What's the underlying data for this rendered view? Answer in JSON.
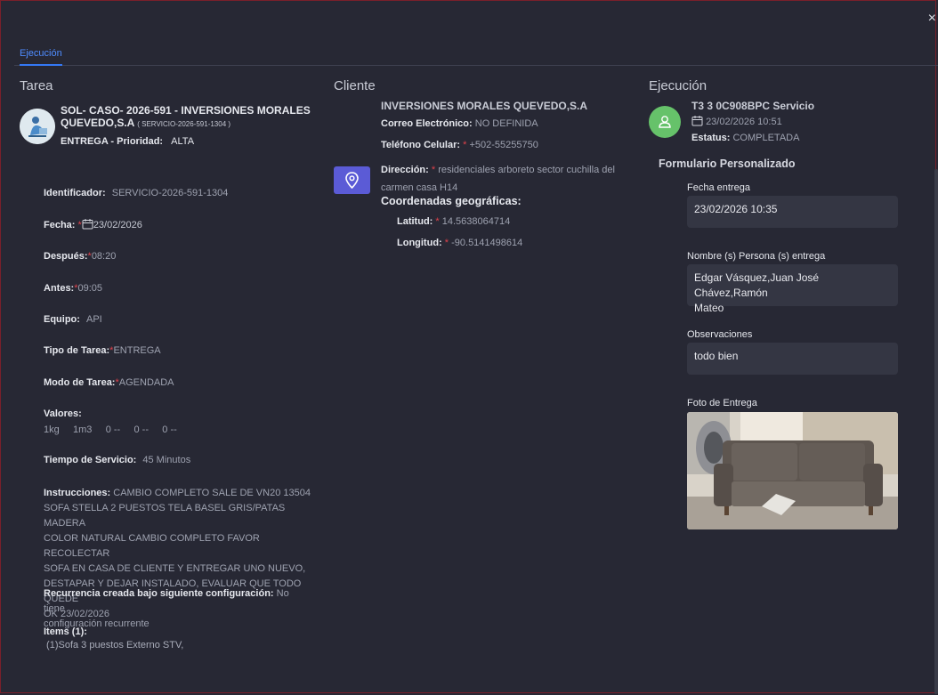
{
  "tabs": [
    {
      "label": "Ejecución"
    }
  ],
  "close_glyph": "×",
  "tarea": {
    "heading": "Tarea",
    "title": "SOL- CASO- 2026-591 - INVERSIONES MORALES QUEVEDO,S.A",
    "title_line1": "SOL- CASO- 2026-591 - INVERSIONES MORALES",
    "title_line2": "QUEVEDO,S.A",
    "service_code": "( SERVICIO-2026-591-1304 )",
    "entrega_label": "ENTREGA - Prioridad:",
    "prioridad": "ALTA",
    "fields": {
      "identificador_label": "Identificador:",
      "identificador": "SERVICIO-2026-591-1304",
      "fecha_label": "Fecha:",
      "fecha": "23/02/2026",
      "despues_label": "Después:",
      "despues": "08:20",
      "antes_label": "Antes:",
      "antes": "09:05",
      "equipo_label": "Equipo:",
      "equipo": "API",
      "tipo_label": "Tipo de Tarea:",
      "tipo": "ENTREGA",
      "modo_label": "Modo de Tarea:",
      "modo": "AGENDADA",
      "valores_label": "Valores:",
      "valores": [
        "1kg",
        "1m3",
        "0 --",
        "0 --",
        "0 --"
      ],
      "tiempo_label": "Tiempo de Servicio:",
      "tiempo": "45 Minutos",
      "instrucciones_label": "Instrucciones:",
      "instrucciones_lines": [
        "CAMBIO COMPLETO SALE DE VN20 13504",
        "SOFA STELLA 2 PUESTOS TELA BASEL GRIS/PATAS MADERA",
        "COLOR NATURAL CAMBIO COMPLETO FAVOR RECOLECTAR",
        "SOFA EN CASA DE CLIENTE Y ENTREGAR UNO NUEVO,",
        "DESTAPAR Y DEJAR INSTALADO, EVALUAR QUE TODO QUEDE",
        "OK 23/02/2026"
      ],
      "recurrencia_label": "Recurrencia creada bajo siguiente configuración:",
      "recurrencia_line1": "No tiene",
      "recurrencia_line2": "configuración recurrente",
      "items_label": "Items (1):",
      "items": [
        " (1)Sofa 3 puestos Externo STV,"
      ]
    }
  },
  "cliente": {
    "heading": "Cliente",
    "name": "INVERSIONES MORALES QUEVEDO,S.A",
    "correo_label": "Correo Electrónico:",
    "correo": "NO DEFINIDA",
    "telefono_label": "Teléfono Celular:",
    "telefono": "+502-55255750",
    "direccion_label": "Dirección:",
    "direccion_line1": "residenciales arboreto sector cuchilla del",
    "direccion_line2": "carmen casa H14",
    "coords_label": "Coordenadas geográficas:",
    "latitud_label": "Latitud:",
    "latitud": "14.5638064714",
    "longitud_label": "Longitud:",
    "longitud": "-90.5141498614",
    "icon": "map-pin-icon",
    "icon_color": "#5b5bd6"
  },
  "ejecucion": {
    "heading": "Ejecución",
    "device": "T3 3 0C908BPC Servicio",
    "datetime": "23/02/2026 10:51",
    "estatus_label": "Estatus:",
    "estatus": "COMPLETADA",
    "avatar_color": "#66c26a",
    "form_title": "Formulario Personalizado",
    "form": {
      "fecha_label": "Fecha entrega",
      "fecha_value": "23/02/2026 10:35",
      "nombre_label": "Nombre (s) Persona (s) entrega",
      "nombre_line1": "Edgar Vásquez,Juan José Chávez,Ramón",
      "nombre_line2": "Mateo",
      "observaciones_label": "Observaciones",
      "observaciones_value": "todo bien",
      "foto_label": "Foto de Entrega"
    }
  },
  "colors": {
    "accent": "#3478f6",
    "required": "#e0424b",
    "background": "#272834"
  }
}
